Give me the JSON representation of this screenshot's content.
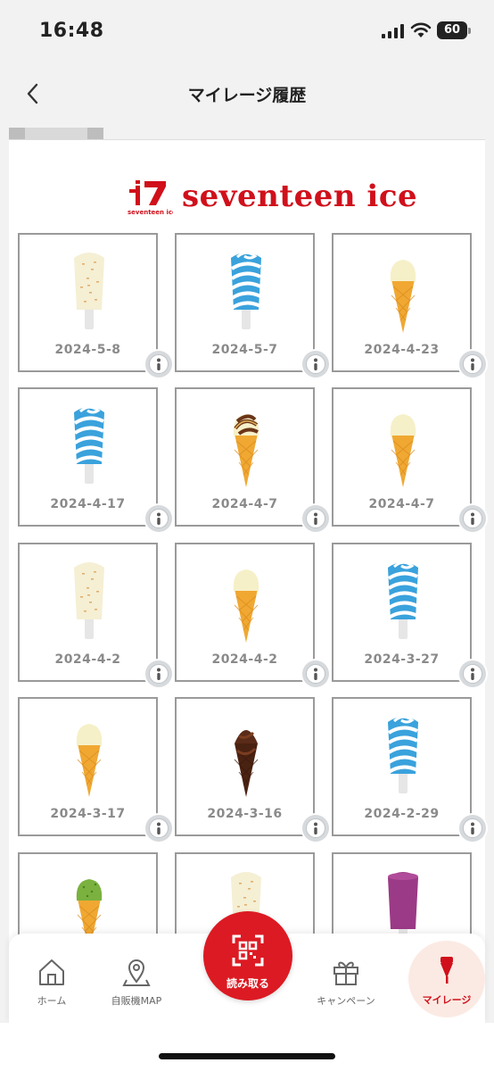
{
  "status_bar": {
    "time": "16:48",
    "battery": "60"
  },
  "header": {
    "title": "マイレージ履歴"
  },
  "brand": {
    "name": "seventeen ice",
    "mark_text": "seventeen ice",
    "color": "#d0101b"
  },
  "history": [
    {
      "date": "2024-5-8",
      "product": "vanilla-sprinkle-bar"
    },
    {
      "date": "2024-5-7",
      "product": "soda-swirl-bar"
    },
    {
      "date": "2024-4-23",
      "product": "vanilla-cone"
    },
    {
      "date": "2024-4-17",
      "product": "soda-swirl-bar"
    },
    {
      "date": "2024-4-7",
      "product": "choco-swirl-cone"
    },
    {
      "date": "2024-4-7",
      "product": "vanilla-cone"
    },
    {
      "date": "2024-4-2",
      "product": "vanilla-sprinkle-bar"
    },
    {
      "date": "2024-4-2",
      "product": "vanilla-cone"
    },
    {
      "date": "2024-3-27",
      "product": "soda-swirl-bar"
    },
    {
      "date": "2024-3-17",
      "product": "vanilla-cone"
    },
    {
      "date": "2024-3-16",
      "product": "chocolate-cone"
    },
    {
      "date": "2024-2-29",
      "product": "soda-swirl-bar"
    },
    {
      "date": "",
      "product": "matcha-cone"
    },
    {
      "date": "",
      "product": "vanilla-sprinkle-bar"
    },
    {
      "date": "",
      "product": "grape-bar"
    }
  ],
  "nav": {
    "home": "ホーム",
    "map": "自販機MAP",
    "scan": "読み取る",
    "campaign": "キャンペーン",
    "mileage": "マイレージ"
  },
  "colors": {
    "accent": "#dc1a23",
    "active_bg": "#fbeae3"
  }
}
